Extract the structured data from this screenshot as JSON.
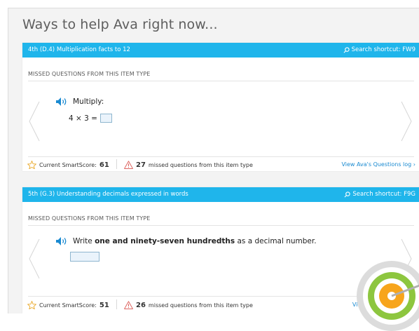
{
  "heading": "Ways to help Ava right now...",
  "cards": [
    {
      "skill_title": "4th (D.4)  Multiplication facts to 12",
      "shortcut": "Search shortcut: FW9",
      "section_label": "MISSED QUESTIONS FROM THIS ITEM TYPE",
      "prompt": "Multiply:",
      "math_expr": "4 × 3 =",
      "smartscore_label": "Current SmartScore:",
      "smartscore": "61",
      "missed_count": "27",
      "missed_text": "missed questions from this item type",
      "log_link": "View Ava's Questions log ›"
    },
    {
      "skill_title": "5th (G.3)  Understanding decimals expressed in words",
      "shortcut": "Search shortcut: F9G",
      "section_label": "MISSED QUESTIONS FROM THIS ITEM TYPE",
      "prompt_pre": "Write",
      "prompt_bold": "one and ninety-seven hundredths",
      "prompt_post": "as a decimal number.",
      "smartscore_label": "Current SmartScore:",
      "smartscore": "51",
      "missed_count": "26",
      "missed_text": "missed questions from this item type",
      "log_link": "View Ava"
    }
  ],
  "colors": {
    "skill_bar": "#1fb5eb",
    "link": "#1a8ad1",
    "warning": "#d9534f",
    "star": "#e9a623",
    "target_ring": "#8dc63f",
    "target_center": "#f7a51c"
  }
}
